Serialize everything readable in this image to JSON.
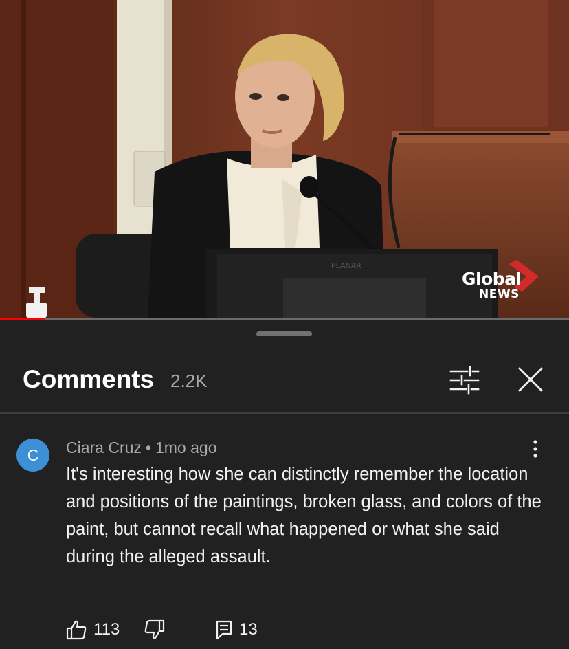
{
  "video": {
    "logo_text": "Global",
    "logo_subtext": "NEWS",
    "progress": 0.08
  },
  "comments_panel": {
    "title": "Comments",
    "count": "2.2K",
    "icons": {
      "filter": "sliders-icon",
      "close": "close-icon",
      "more": "more-vertical-icon"
    },
    "comment": {
      "avatar_letter": "C",
      "avatar_color": "#3d8fd6",
      "author": "Ciara Cruz",
      "separator": "•",
      "time": "1mo ago",
      "text": "It's interesting how she can distinctly remember the location and positions of the paintings, broken glass, and colors of the paint, but cannot recall what happened or what she said during the alleged assault.",
      "likes": "113",
      "replies": "13",
      "action_icons": {
        "like": "thumbs-up-icon",
        "dislike": "thumbs-down-icon",
        "reply": "reply-icon"
      }
    }
  }
}
